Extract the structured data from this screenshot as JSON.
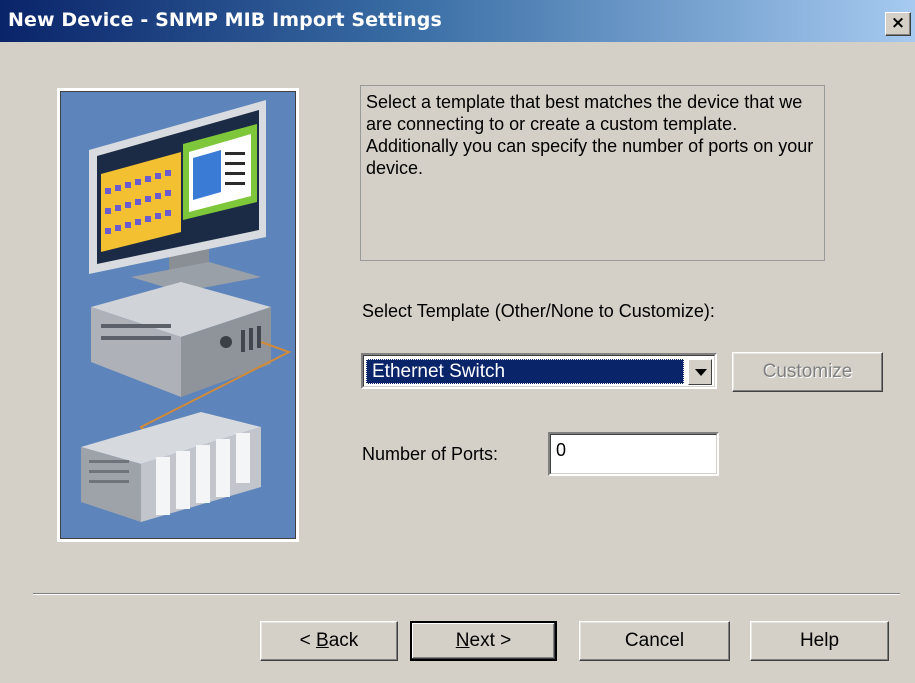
{
  "window": {
    "title": "New Device - SNMP MIB Import Settings",
    "close_label": "×"
  },
  "description": "Select a template that best matches the device that we are connecting to or create a custom template. Additionally you can specify the number of ports on your device.",
  "template": {
    "label": "Select Template (Other/None to Customize):",
    "selected": "Ethernet Switch",
    "customize_label": "Customize"
  },
  "ports": {
    "label": "Number of Ports:",
    "value": "0"
  },
  "buttons": {
    "back_prefix": "< ",
    "back_key": "B",
    "back_rest": "ack",
    "next_key": "N",
    "next_rest": "ext >",
    "cancel": "Cancel",
    "help": "Help"
  },
  "colors": {
    "title_gradient_start": "#0a246a",
    "title_gradient_end": "#a6caf0",
    "face": "#d4d0c8",
    "selection": "#0a246a"
  }
}
